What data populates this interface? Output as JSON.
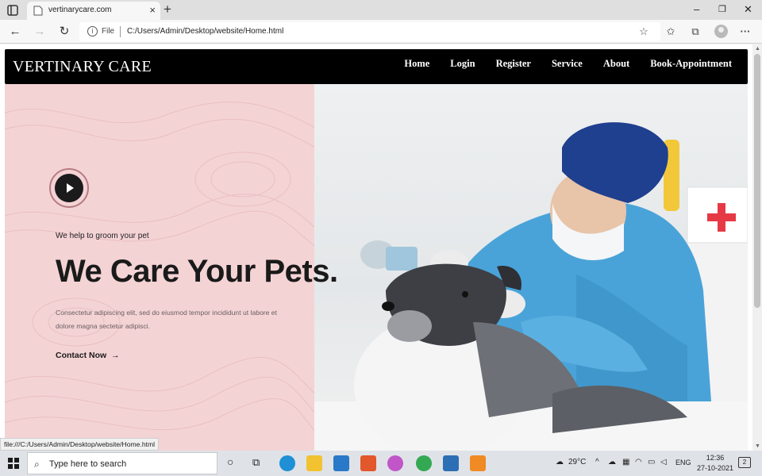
{
  "browser": {
    "tab_title": "vertinarycare.com",
    "new_tab_symbol": "+",
    "close_symbol": "×",
    "site_label": "File",
    "url": "C:/Users/Admin/Desktop/website/Home.html",
    "status_url": "file:///C:/Users/Admin/Desktop/website/Home.html",
    "window_controls": {
      "minimize": "–",
      "restore": "❐",
      "close": "✕"
    }
  },
  "site": {
    "brand": "VERTINARY CARE",
    "menu": [
      "Home",
      "Login",
      "Register",
      "Service",
      "About",
      "Book-Appointment"
    ],
    "hero": {
      "tagline": "We help to groom your pet",
      "headline": "We Care Your Pets.",
      "description": "Consectetur adipiscing elit, sed do eiusmod tempor incididunt ut labore et dolore magna sectetur adipisci.",
      "cta": "Contact Now",
      "cta_arrow": "→"
    },
    "colors": {
      "nav_bg": "#000000",
      "hero_left_bg": "#f4d3d5",
      "scrub_blue": "#4aa3d8",
      "cap_blue": "#1f3f8f"
    }
  },
  "taskbar": {
    "search_placeholder": "Type here to search",
    "weather": "29°C",
    "language": "ENG",
    "time": "12:36",
    "date": "27-10-2021",
    "notification_count": "2"
  }
}
